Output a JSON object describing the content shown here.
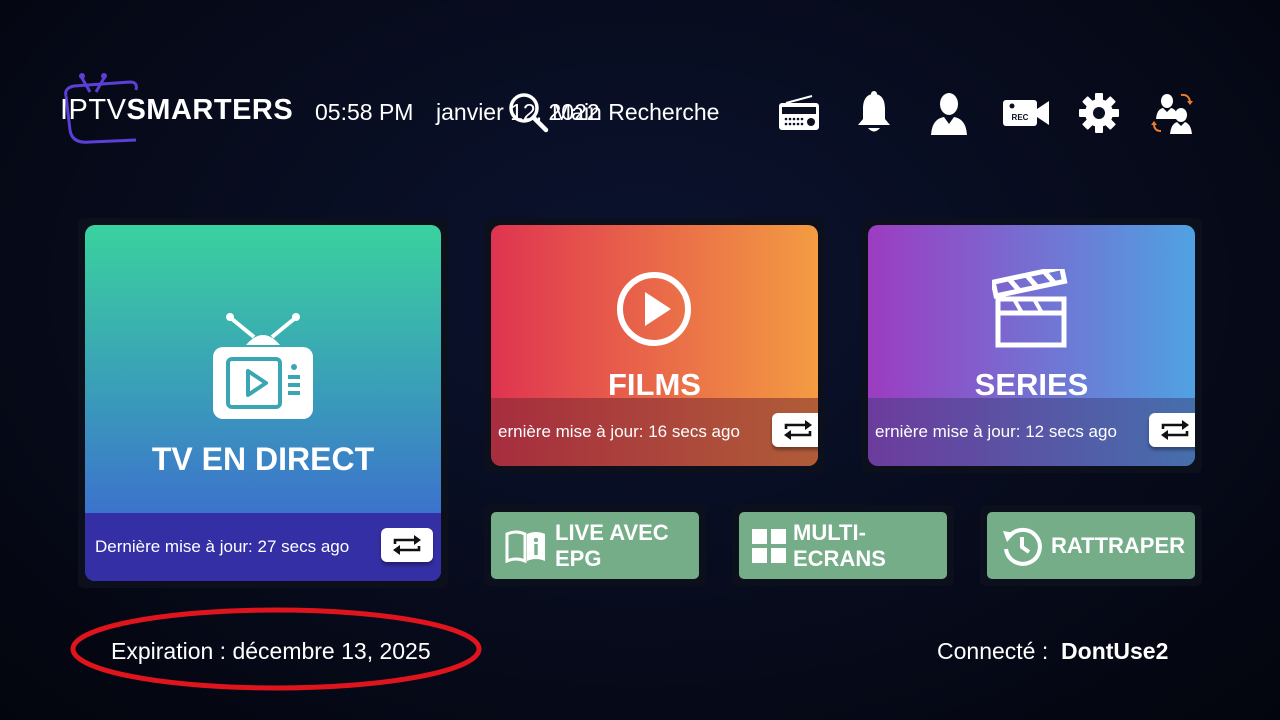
{
  "header": {
    "logo_iptv": "IPTV",
    "logo_smarters": "SMARTERS",
    "time": "05:58 PM",
    "date": "janvier 12, 2022",
    "search_label": "Main Recherche",
    "icons": [
      "radio-icon",
      "bell-icon",
      "user-icon",
      "record-camera-icon",
      "gear-icon",
      "switch-user-icon"
    ],
    "rec_text": "REC"
  },
  "tiles": {
    "live": {
      "title": "TV EN DIRECT",
      "update": "Dernière mise à jour: 27 secs ago"
    },
    "films": {
      "title": "FILMS",
      "update": "ernière mise à jour: 16 secs ago"
    },
    "series": {
      "title": "SERIES",
      "update": "ernière mise à jour: 12 secs ago"
    }
  },
  "buttons": {
    "epg": {
      "line1": "LIVE AVEC",
      "line2": "EPG"
    },
    "multi": {
      "line1": "MULTI-",
      "line2": "ECRANS"
    },
    "catchup": {
      "label": "RATTRAPER"
    }
  },
  "footer": {
    "expiration": "Expiration : décembre 13, 2025",
    "connected_label": "Connecté :",
    "username": "DontUse2"
  },
  "colors": {
    "live_gradient": [
      "#3ad29e",
      "#3d5bd8",
      "#3a2fa6"
    ],
    "films_gradient": [
      "#e0334f",
      "#f39c42"
    ],
    "series_gradient": [
      "#9c3cc1",
      "#4fa2e2"
    ],
    "button_green": "#74ad88",
    "annotation_red": "#e0141c"
  }
}
